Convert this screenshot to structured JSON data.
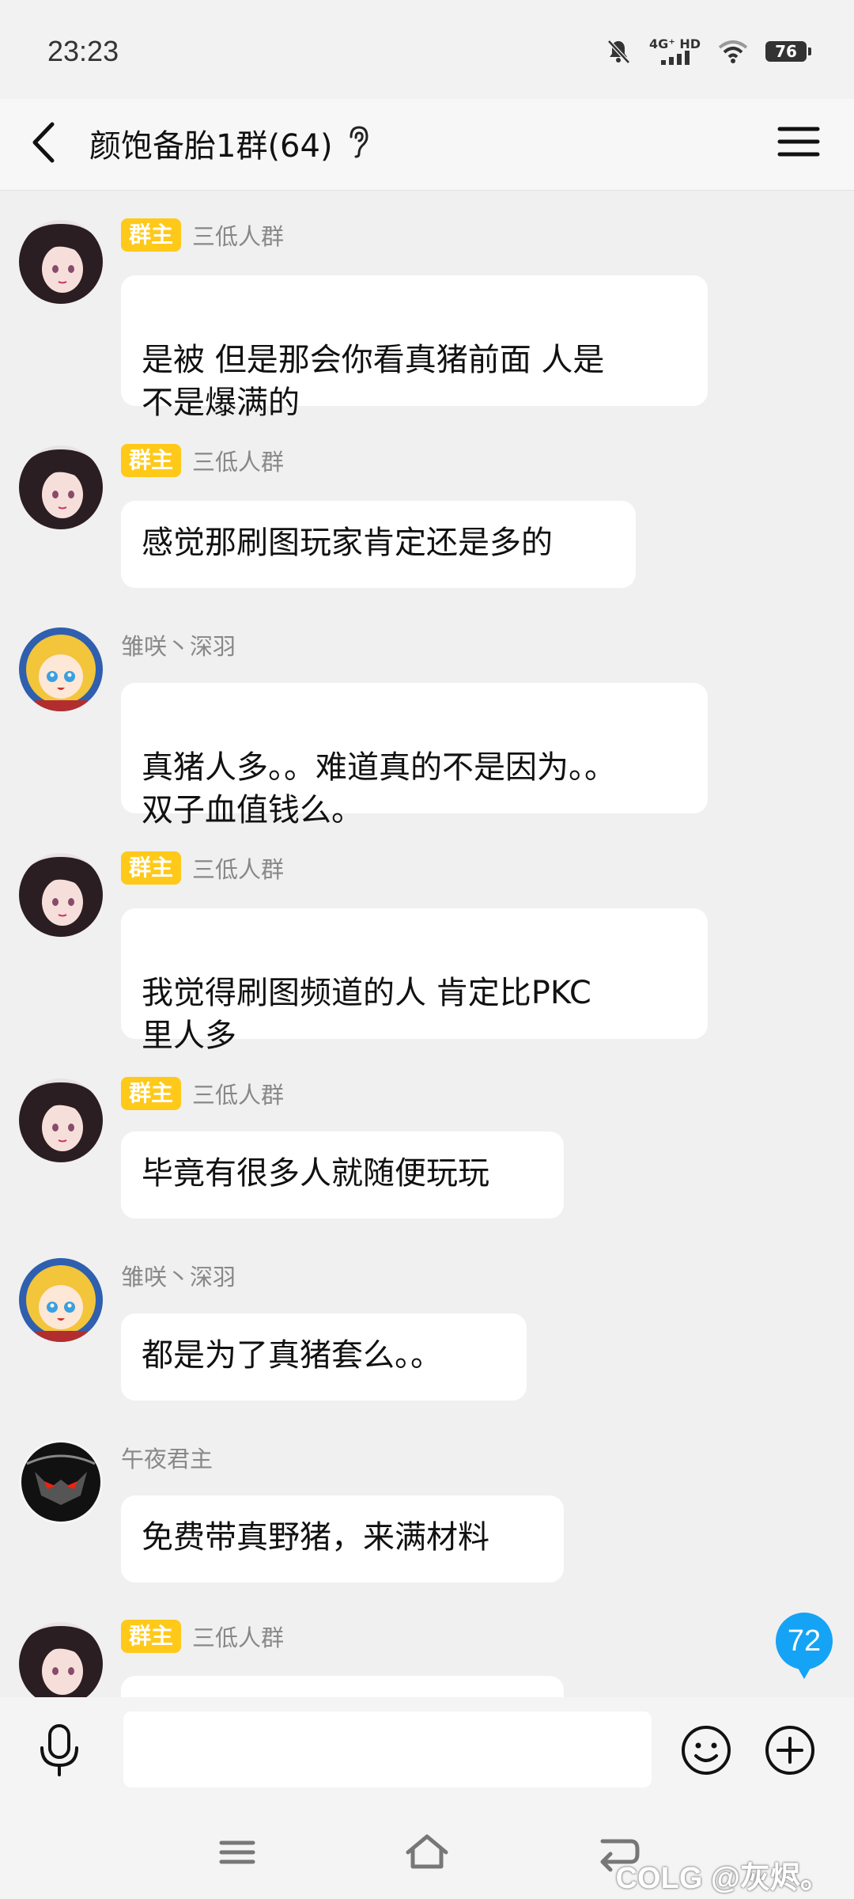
{
  "status_bar": {
    "time": "23:23",
    "network": "4G⁺ HD",
    "battery": "76"
  },
  "header": {
    "title": "颜饱备胎1群(64)"
  },
  "badge_label": "群主",
  "messages": [
    {
      "sender": "三低人群",
      "is_owner": true,
      "text": "是被 但是那会你看真猪前面 人是\n不是爆满的"
    },
    {
      "sender": "三低人群",
      "is_owner": true,
      "text": "感觉那刷图玩家肯定还是多的"
    },
    {
      "sender": "雏咲丶深羽",
      "is_owner": false,
      "text": "真猪人多。。难道真的不是因为。。\n双子血值钱么。"
    },
    {
      "sender": "三低人群",
      "is_owner": true,
      "text": "我觉得刷图频道的人 肯定比PKC\n里人多"
    },
    {
      "sender": "三低人群",
      "is_owner": true,
      "text": "毕竟有很多人就随便玩玩"
    },
    {
      "sender": "雏咲丶深羽",
      "is_owner": false,
      "text": "都是为了真猪套么。。"
    },
    {
      "sender": "午夜君主",
      "is_owner": false,
      "text": "免费带真野猪，来满材料"
    },
    {
      "sender": "三低人群",
      "is_owner": true,
      "text": ""
    }
  ],
  "unread_count": "72",
  "input": {
    "value": "",
    "placeholder": ""
  },
  "watermark": "COLG @灰烬。",
  "icons": {
    "back": "back-arrow-icon",
    "ear": "ear-icon",
    "menu": "menu-icon",
    "mic": "microphone-icon",
    "emoji": "emoji-icon",
    "plus": "plus-icon"
  },
  "colors": {
    "badge": "#ffc91a",
    "unread": "#15a3f5",
    "background": "#f0f0f0"
  }
}
